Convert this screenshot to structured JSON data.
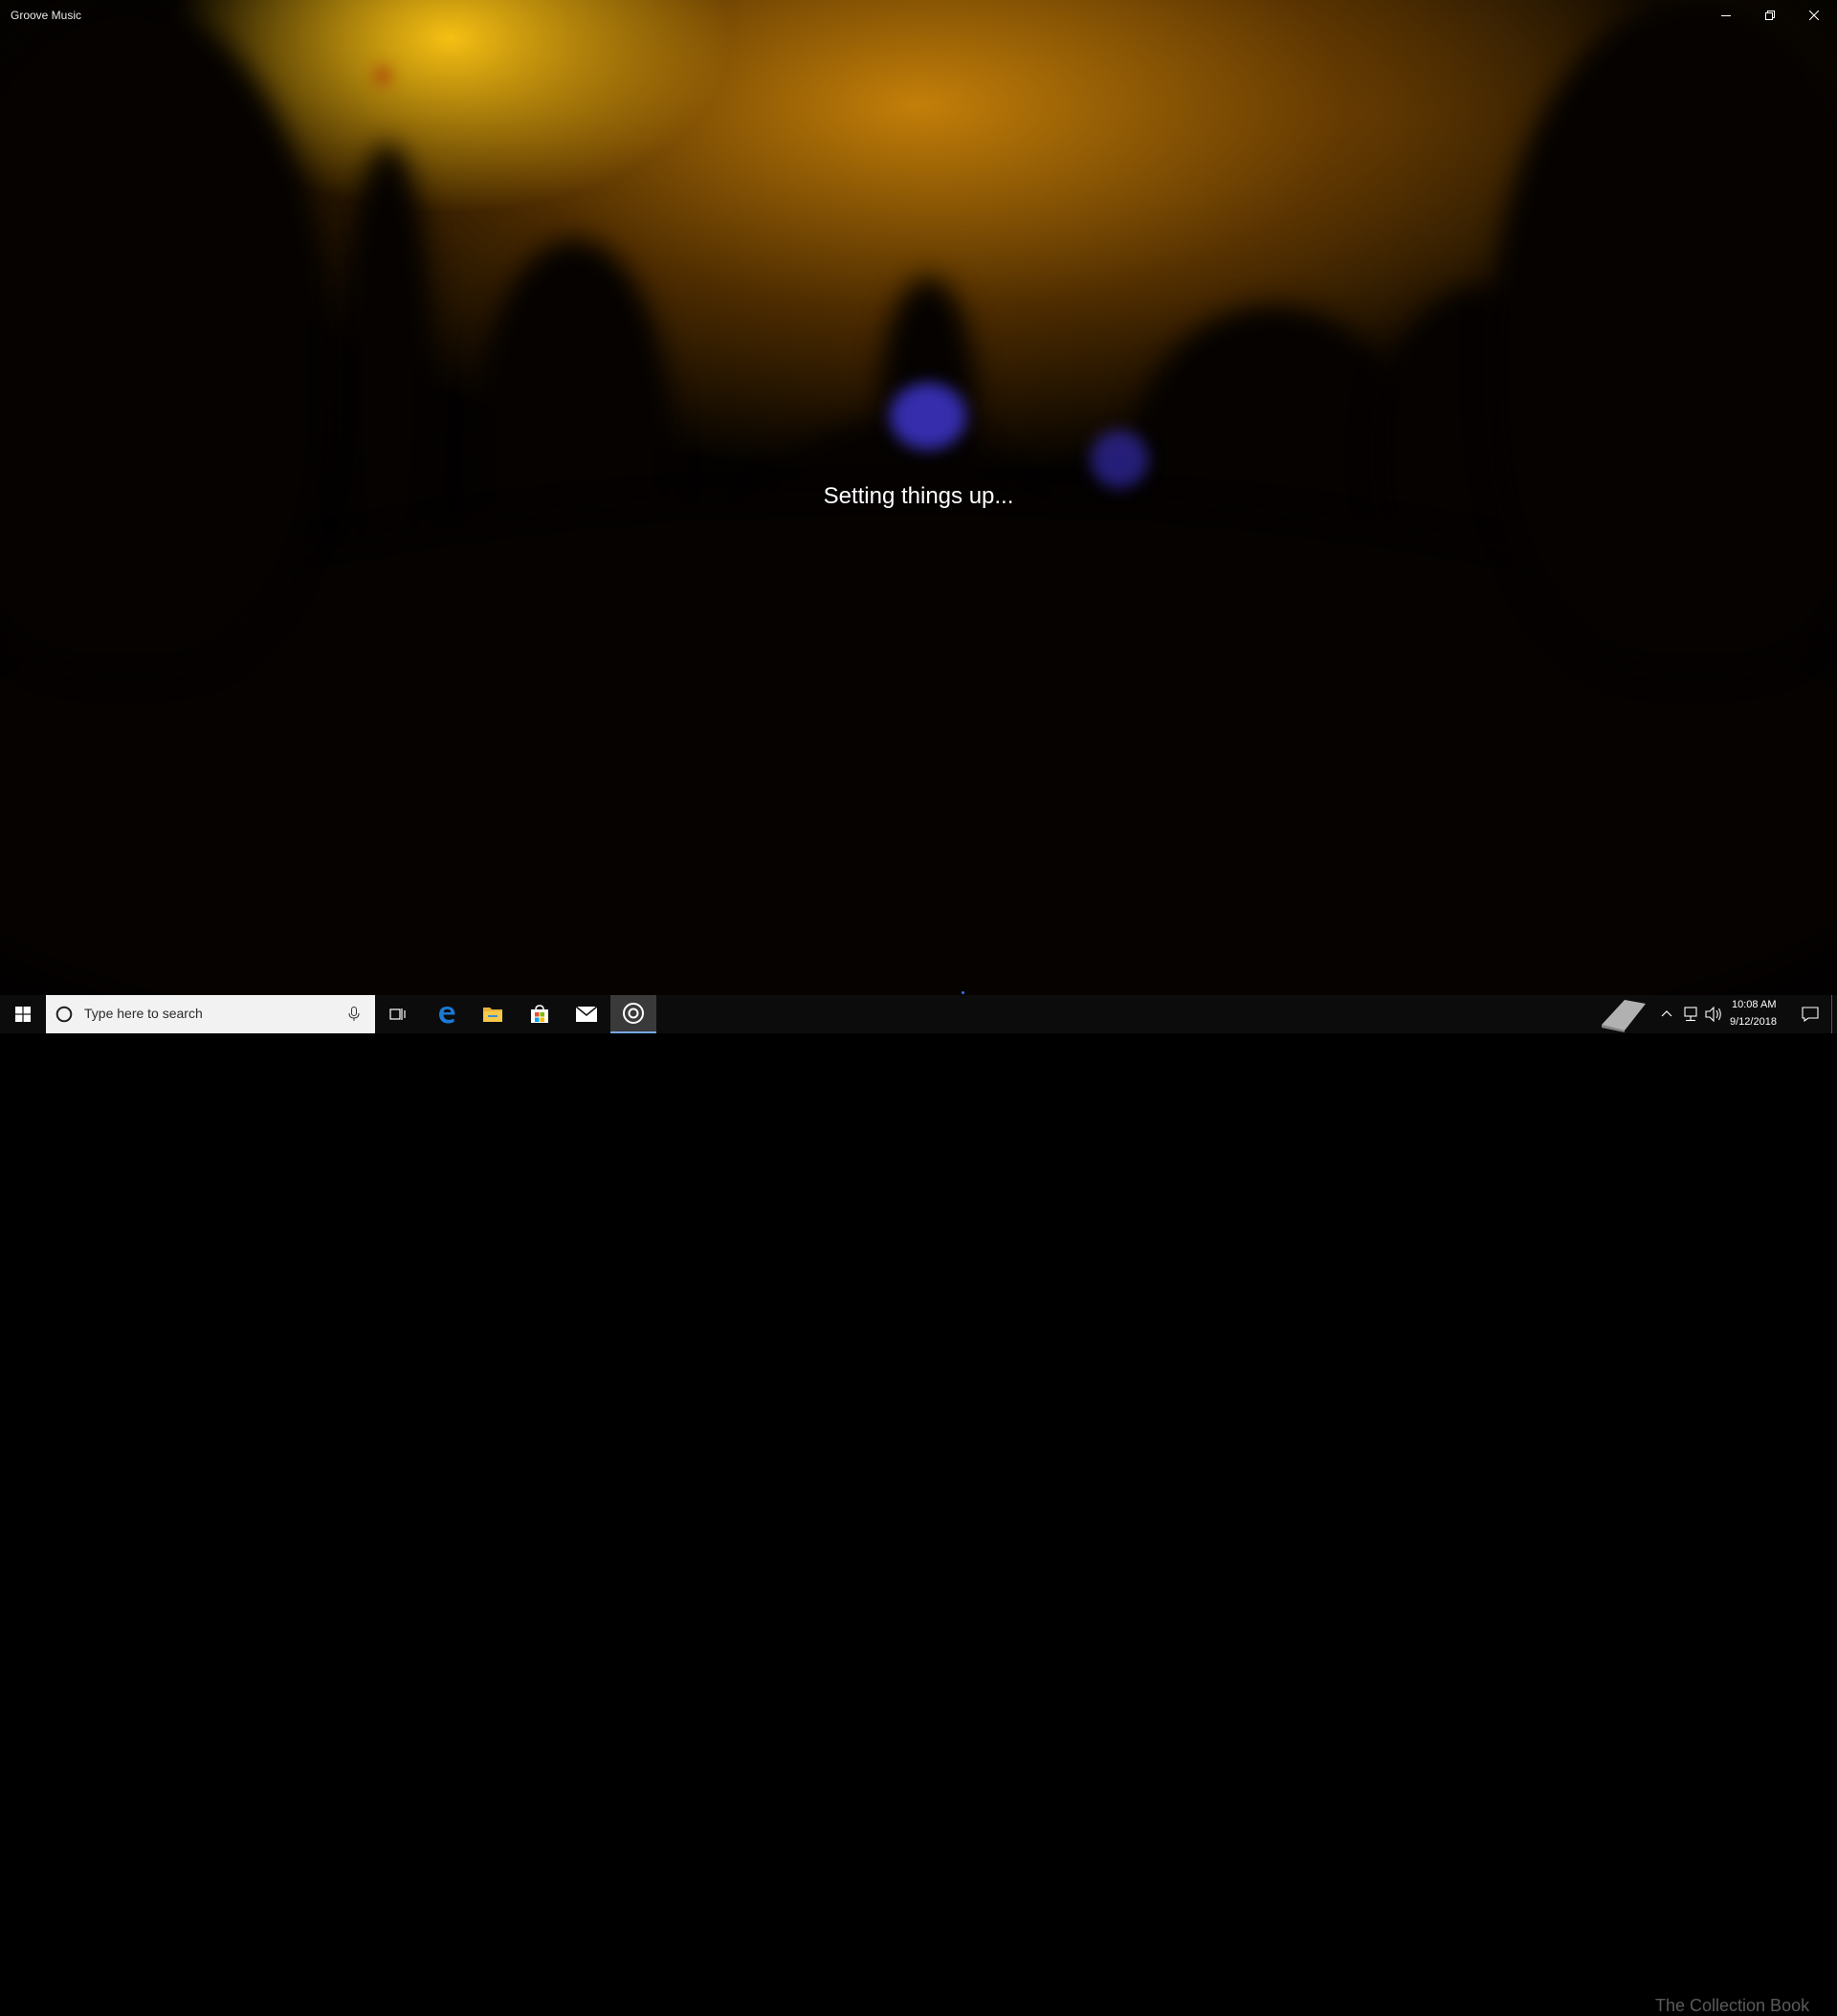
{
  "window": {
    "title": "Groove Music"
  },
  "main": {
    "status_text": "Setting things up..."
  },
  "taskbar": {
    "search_placeholder": "Type here to search",
    "watermark_text": "The Collection Book",
    "clock": {
      "time": "10:08 AM",
      "date": "9/12/2018"
    }
  },
  "icons": [
    "minimize-icon",
    "restore-icon",
    "close-icon",
    "windows-start-icon",
    "cortana-icon",
    "microphone-icon",
    "task-view-icon",
    "edge-icon",
    "file-explorer-icon",
    "store-icon",
    "mail-icon",
    "groove-music-icon",
    "book-icon",
    "chevron-up-icon",
    "network-icon",
    "volume-icon",
    "action-center-icon"
  ],
  "colors": {
    "accent": "#76a9e8",
    "edge_blue": "#1a7ad4",
    "folder_yellow": "#f7c948",
    "taskbar_bg": "#0c0c0c"
  }
}
